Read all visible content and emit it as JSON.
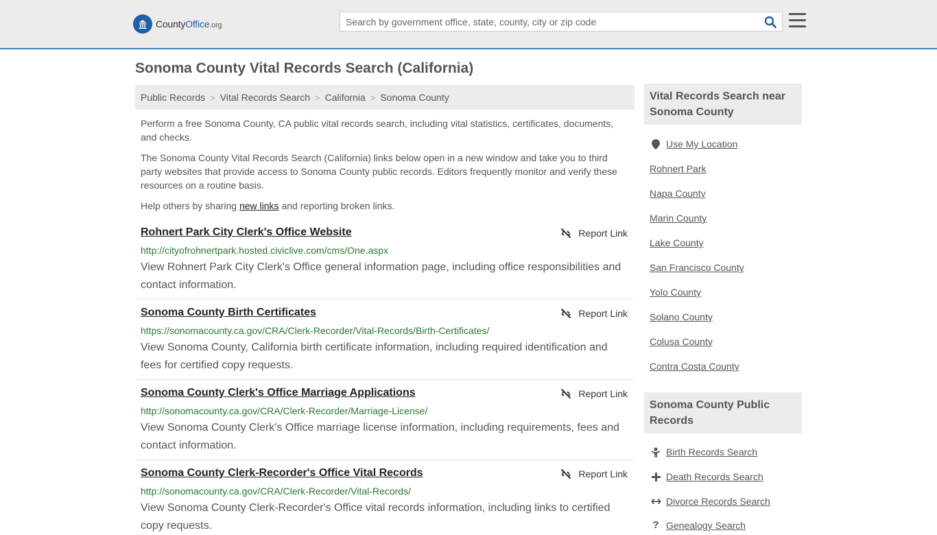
{
  "header": {
    "logo": {
      "brand_part1": "County",
      "brand_part2": "Office",
      "tld": ".org"
    },
    "search": {
      "placeholder": "Search by government office, state, county, city or zip code",
      "value": ""
    }
  },
  "page_title": "Sonoma County Vital Records Search (California)",
  "breadcrumb": [
    "Public Records",
    "Vital Records Search",
    "California",
    "Sonoma County"
  ],
  "intro": {
    "p1": "Perform a free Sonoma County, CA public vital records search, including vital statistics, certificates, documents, and checks.",
    "p2": "The Sonoma County Vital Records Search (California) links below open in a new window and take you to third party websites that provide access to Sonoma County public records. Editors frequently monitor and verify these resources on a routine basis.",
    "p3_before": "Help others by sharing ",
    "p3_link": "new links",
    "p3_after": " and reporting broken links."
  },
  "report_label": "Report Link",
  "results": [
    {
      "title": "Rohnert Park City Clerk's Office Website",
      "url": "http://cityofrohnertpark.hosted.civiclive.com/cms/One.aspx",
      "desc": "View Rohnert Park City Clerk's Office general information page, including office responsibilities and contact information."
    },
    {
      "title": "Sonoma County Birth Certificates",
      "url": "https://sonomacounty.ca.gov/CRA/Clerk-Recorder/Vital-Records/Birth-Certificates/",
      "desc": "View Sonoma County, California birth certificate information, including required identification and fees for certified copy requests."
    },
    {
      "title": "Sonoma County Clerk's Office Marriage Applications",
      "url": "http://sonomacounty.ca.gov/CRA/Clerk-Recorder/Marriage-License/",
      "desc": "View Sonoma County Clerk's Office marriage license information, including requirements, fees and contact information."
    },
    {
      "title": "Sonoma County Clerk-Recorder's Office Vital Records",
      "url": "http://sonomacounty.ca.gov/CRA/Clerk-Recorder/Vital-Records/",
      "desc": "View Sonoma County Clerk-Recorder's Office vital records information, including links to certified copy requests."
    }
  ],
  "sidebar": {
    "nearby_heading": "Vital Records Search near Sonoma County",
    "use_location": "Use My Location",
    "nearby": [
      "Rohnert Park",
      "Napa County",
      "Marin County",
      "Lake County",
      "San Francisco County",
      "Yolo County",
      "Solano County",
      "Colusa County",
      "Contra Costa County"
    ],
    "public_heading": "Sonoma County Public Records",
    "public_links": [
      {
        "label": "Birth Records Search",
        "icon": "baby-icon"
      },
      {
        "label": "Death Records Search",
        "icon": "cross-icon"
      },
      {
        "label": "Divorce Records Search",
        "icon": "split-arrows-icon"
      },
      {
        "label": "Genealogy Search",
        "icon": "question-icon"
      }
    ]
  },
  "colors": {
    "accent": "#3a7ec0",
    "brand": "#1f5fa3",
    "url_green": "#2a7a2a",
    "panel_gray": "#ececec"
  }
}
